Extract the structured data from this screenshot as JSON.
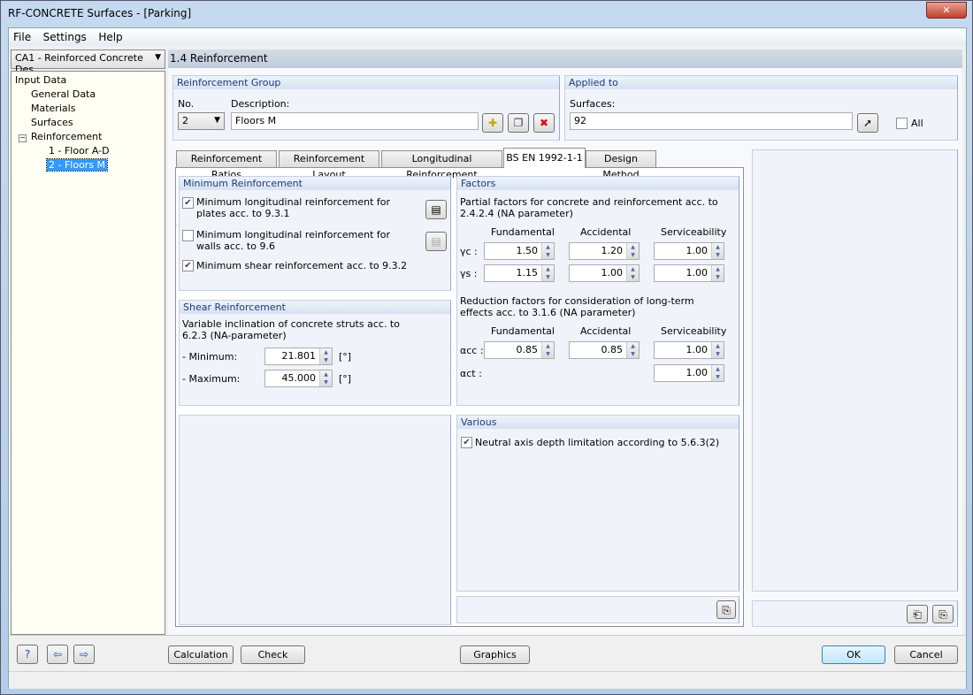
{
  "window": {
    "title": "RF-CONCRETE Surfaces - [Parking]",
    "close": "✕"
  },
  "menu": [
    "File",
    "Settings",
    "Help"
  ],
  "case_combo": "CA1 - Reinforced Concrete Des",
  "tree": {
    "root": "Input Data",
    "items": [
      "General Data",
      "Materials",
      "Surfaces",
      "Reinforcement"
    ],
    "children": [
      "1 - Floor A-D",
      "2 - Floors M"
    ],
    "selected": "2 - Floors M"
  },
  "section_title": "1.4 Reinforcement",
  "group": {
    "title": "Reinforcement Group",
    "no_label": "No.",
    "no_value": "2",
    "desc_label": "Description:",
    "desc_value": "Floors M"
  },
  "applied": {
    "title": "Applied to",
    "surfaces_label": "Surfaces:",
    "surfaces_value": "92",
    "all_label": "All",
    "all_checked": false
  },
  "tabs": [
    "Reinforcement Ratios",
    "Reinforcement Layout",
    "Longitudinal Reinforcement",
    "BS EN 1992-1-1",
    "Design Method"
  ],
  "active_tab": "BS EN 1992-1-1",
  "min_reinf": {
    "title": "Minimum Reinforcement",
    "items": [
      {
        "label": "Minimum longitudinal reinforcement for plates acc. to 9.3.1",
        "checked": true
      },
      {
        "label": "Minimum longitudinal reinforcement for walls acc. to 9.6",
        "checked": false
      },
      {
        "label": "Minimum shear reinforcement acc. to 9.3.2",
        "checked": true
      }
    ]
  },
  "shear": {
    "title": "Shear Reinforcement",
    "desc": "Variable inclination of concrete struts acc. to 6.2.3 (NA-parameter)",
    "min_label": "- Minimum:",
    "min_value": "21.801",
    "max_label": "- Maximum:",
    "max_value": "45.000",
    "unit": "[°]"
  },
  "factors": {
    "title": "Factors",
    "partial_desc": "Partial factors for concrete and reinforcement acc. to 2.4.2.4 (NA parameter)",
    "cols": [
      "Fundamental",
      "Accidental",
      "Serviceability"
    ],
    "gamma_c": {
      "label": "γc :",
      "values": [
        "1.50",
        "1.20",
        "1.00"
      ]
    },
    "gamma_s": {
      "label": "γs :",
      "values": [
        "1.15",
        "1.00",
        "1.00"
      ]
    },
    "reduction_desc": "Reduction factors for consideration of long-term effects acc. to 3.1.6 (NA parameter)",
    "alpha_cc": {
      "label": "αcc :",
      "values": [
        "0.85",
        "0.85",
        "1.00"
      ]
    },
    "alpha_ct": {
      "label": "αct :",
      "value": "1.00"
    }
  },
  "various": {
    "title": "Various",
    "item": "Neutral axis depth limitation according to 5.6.3(2)",
    "checked": true
  },
  "buttons": {
    "calculation": "Calculation",
    "check": "Check",
    "graphics": "Graphics",
    "ok": "OK",
    "cancel": "Cancel"
  }
}
